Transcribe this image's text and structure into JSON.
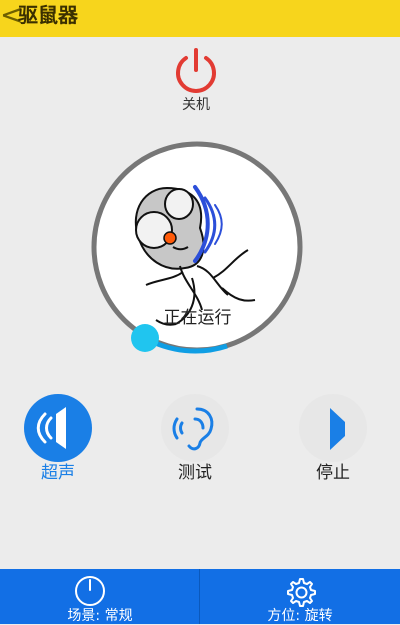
{
  "header": {
    "back_glyph": "<",
    "title": "驱鼠器"
  },
  "power": {
    "icon": "power-icon",
    "label": "关机"
  },
  "dial": {
    "status_text": "正在运行",
    "level": 0.85,
    "accent_color": "#0f9ee4",
    "knob_color": "#20c5ef"
  },
  "modes": [
    {
      "key": "ultrasonic",
      "label": "超声",
      "icon": "speaker-icon",
      "active": true
    },
    {
      "key": "test",
      "label": "测试",
      "icon": "ear-icon",
      "active": false
    },
    {
      "key": "stop",
      "label": "停止",
      "icon": "stop-icon",
      "active": false
    }
  ],
  "bottom_nav": {
    "scene_label": "场景: 常规",
    "scene_icon": "timer-icon",
    "direction_label": "方位: 旋转",
    "direction_icon": "gear-icon"
  },
  "colors": {
    "header_bg": "#f7d51c",
    "power_red": "#e23b33",
    "nav_blue": "#126fe5",
    "active_blue": "#1a7fe6"
  }
}
